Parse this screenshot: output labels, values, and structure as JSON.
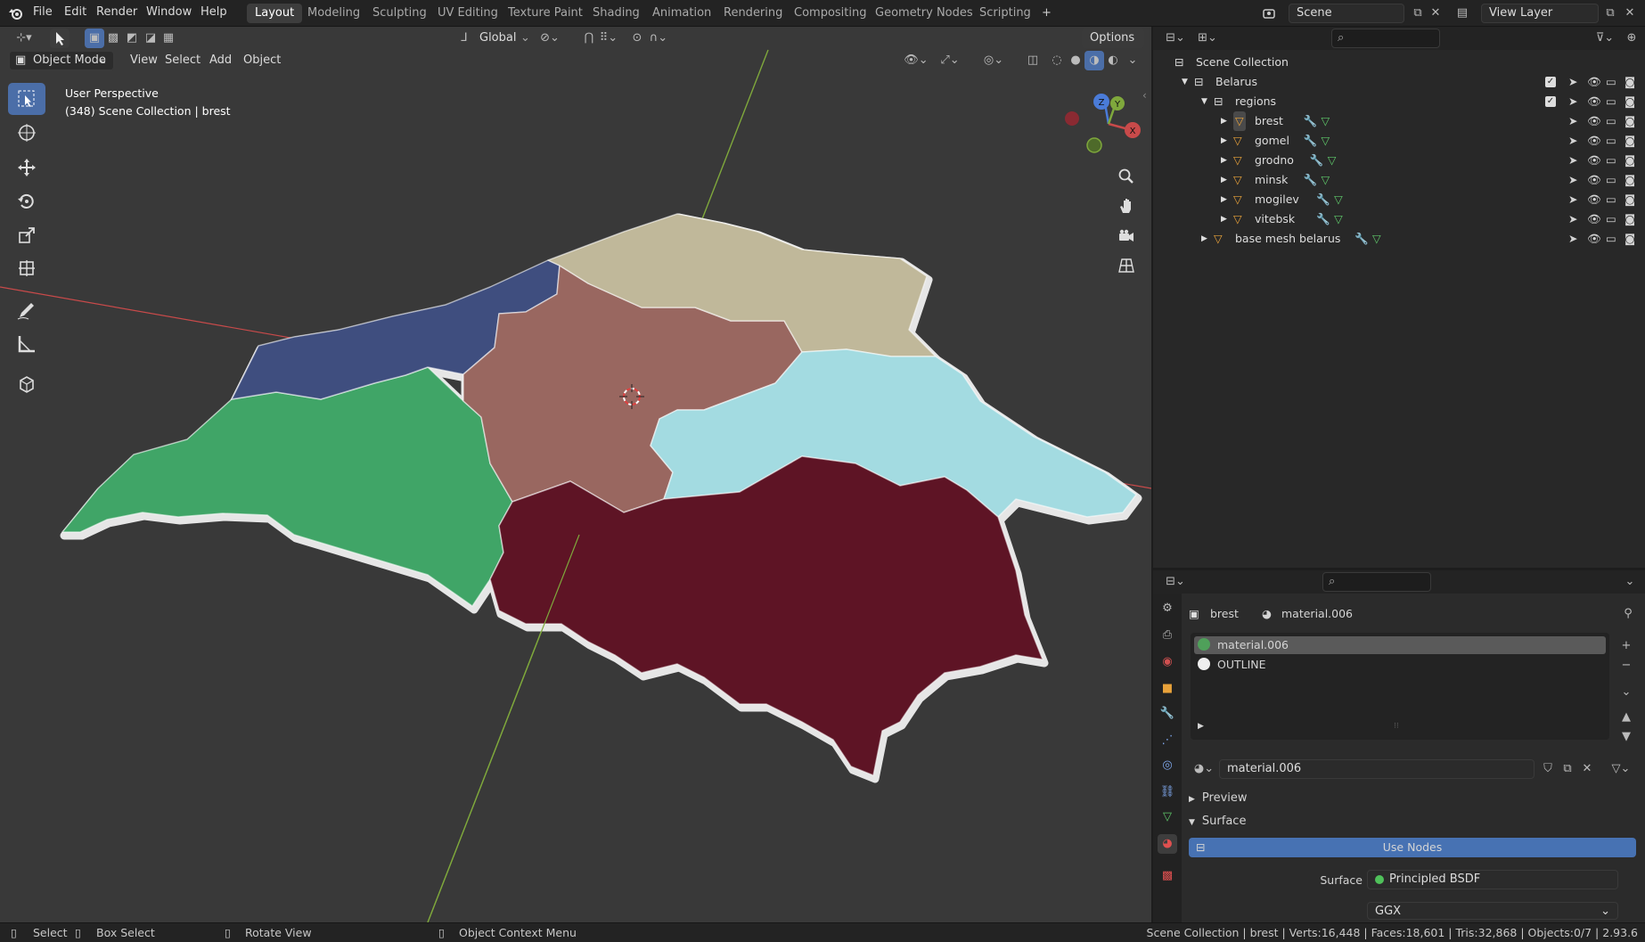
{
  "topbar": {
    "menus": [
      "File",
      "Edit",
      "Render",
      "Window",
      "Help"
    ],
    "workspaces": [
      "Layout",
      "Modeling",
      "Sculpting",
      "UV Editing",
      "Texture Paint",
      "Shading",
      "Animation",
      "Rendering",
      "Compositing",
      "Geometry Nodes",
      "Scripting"
    ],
    "active_workspace": "Layout",
    "add_tab": "+",
    "scene": "Scene",
    "view_layer": "View Layer"
  },
  "viewport": {
    "orientation": "Global",
    "options": "Options",
    "mode": "Object Mode",
    "menus": [
      "View",
      "Select",
      "Add",
      "Object"
    ],
    "overlay_title": "User Perspective",
    "overlay_sub": "(348) Scene Collection | brest",
    "gizmo_axes": [
      "X",
      "Y",
      "Z"
    ],
    "regions": [
      {
        "name": "brest",
        "color": "#5e1425"
      },
      {
        "name": "gomel",
        "color": "#40a567"
      },
      {
        "name": "grodno",
        "color": "#3f4e7f"
      },
      {
        "name": "minsk",
        "color": "#996760"
      },
      {
        "name": "mogilev",
        "color": "#c0b89a"
      },
      {
        "name": "vitebsk",
        "color": "#a3dbe1"
      }
    ],
    "accent_colors": {
      "x_axis": "#c84a4a",
      "y_axis": "#7fa83c",
      "z_axis": "#4a7bd8",
      "selection": "#4b6ea8"
    }
  },
  "outliner": {
    "root": "Scene Collection",
    "collection": "Belarus",
    "subcollection": "regions",
    "objects": [
      "brest",
      "gomel",
      "grodno",
      "minsk",
      "mogilev",
      "vitebsk"
    ],
    "base_mesh": "base mesh belarus"
  },
  "properties": {
    "object": "brest",
    "material": "material.006",
    "slots": [
      "material.006",
      "OUTLINE"
    ],
    "material_field": "material.006",
    "panels": {
      "preview": "Preview",
      "surface": "Surface"
    },
    "use_nodes": "Use Nodes",
    "surface_label": "Surface",
    "surface_value": "Principled BSDF",
    "distribution": "GGX"
  },
  "statusbar": {
    "select": "Select",
    "box_select": "Box Select",
    "rotate": "Rotate View",
    "context": "Object Context Menu",
    "stats": "Scene Collection | brest | Verts:16,448 | Faces:18,601 | Tris:32,868 | Objects:0/7 | 2.93.6"
  }
}
